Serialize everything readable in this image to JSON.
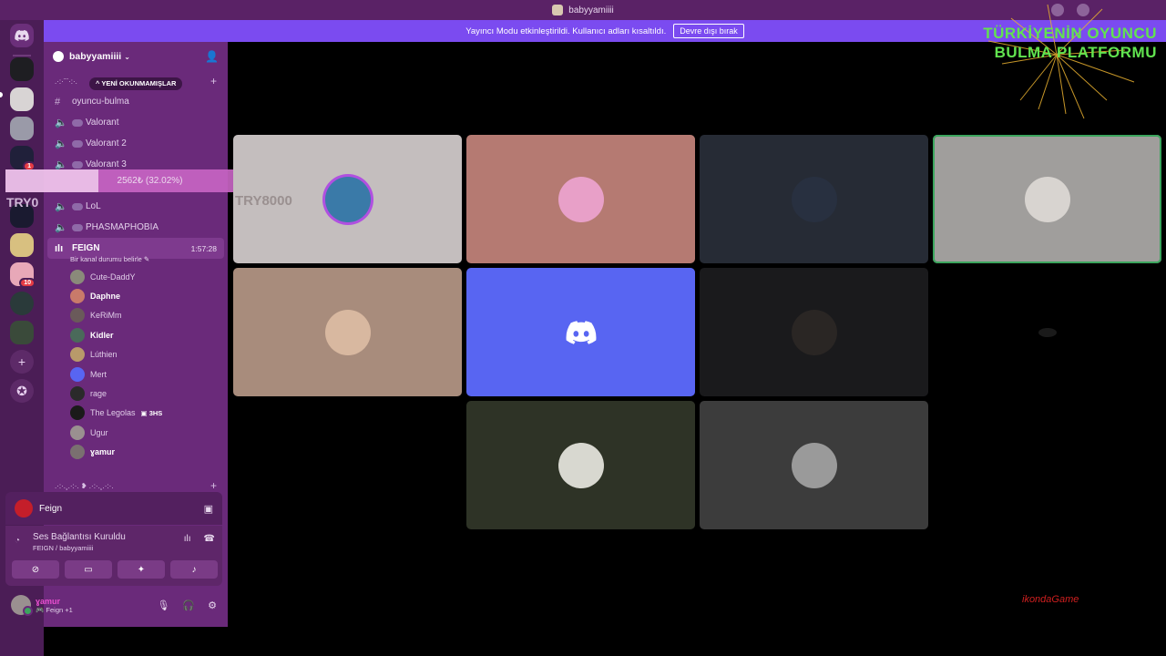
{
  "window": {
    "title": "babyyamiiii"
  },
  "banner": {
    "message": "Yayıncı Modu etkinleştirildi. Kullanıcı adları kısaltıldı.",
    "button_label": "Devre dışı bırak"
  },
  "rail": {
    "badge_1": "1",
    "badge_2": "10",
    "add_icon": "+"
  },
  "guild": {
    "name": "babyyamiiii"
  },
  "categories": {
    "top": ".·:·¨¨·:·.",
    "bottom": ".·:·.¸.·:·. ❥ .·:·.¸.·:·."
  },
  "unread_label": "YENİ OKUNMAMIŞLAR",
  "channels": [
    {
      "name": "oyuncu-bulma",
      "icon": "#"
    },
    {
      "name": "Valorant",
      "icon": "speaker"
    },
    {
      "name": "Valorant 2",
      "icon": "speaker"
    },
    {
      "name": "Valorant 3",
      "icon": "speaker"
    },
    {
      "name": "LoL",
      "icon": "speaker"
    },
    {
      "name": "PHASMAPHOBIA",
      "icon": "speaker"
    }
  ],
  "active_channel": {
    "name": "FEIGN",
    "timer": "1:57:28",
    "status": "Bir kanal durumu belirle"
  },
  "members": [
    {
      "name": "Cute-DaddY",
      "color": "#8a8a7a"
    },
    {
      "name": "Daphne",
      "color": "#c97a6a"
    },
    {
      "name": "KeRiMm",
      "color": "#6a5a5a"
    },
    {
      "name": "Kidler",
      "color": "#4a6a5a"
    },
    {
      "name": "Lúthien",
      "color": "#b89a6a"
    },
    {
      "name": "Mert",
      "color": "#5865f2"
    },
    {
      "name": "rage",
      "color": "#2a2a2a"
    },
    {
      "name": "The Legolas",
      "color": "#1a1a1a",
      "tag": "3HS"
    },
    {
      "name": "Ugur",
      "color": "#9a9090"
    },
    {
      "name": "ɣamur",
      "color": "#7a7070"
    }
  ],
  "progress": {
    "text": "2562₺ (32.02%)",
    "fraction": 0.3202
  },
  "overlay_label": "TRY0",
  "stream_panel": {
    "name": "Feign"
  },
  "voice_panel": {
    "title": "Ses Bağlantısı Kuruldu",
    "subtitle": "FEIGN / babyyamiiii"
  },
  "user_panel": {
    "name": "ɣamur",
    "status": "🎮 Feign +1"
  },
  "tiles": [
    {
      "bg": "#c4bebe",
      "avatar": "#3a7aa8",
      "label": "TRY8000"
    },
    {
      "bg": "#b57a72",
      "avatar": "#e8a0c8"
    },
    {
      "bg": "#262b35",
      "avatar": "#283040"
    },
    {
      "bg": "#a09e9c",
      "avatar": "#d8d4d0",
      "speaking": true
    },
    {
      "bg": "#a88c7c",
      "avatar": "#d8b8a0"
    },
    {
      "bg": "#5865f2",
      "avatar": "discord"
    },
    {
      "bg": "#1a1a1c",
      "avatar": "#2a2624"
    },
    {
      "bg": "#000000",
      "avatar": "#1a1a1a"
    },
    {
      "bg": "#2e3326",
      "avatar": "#d8d8d0"
    },
    {
      "bg": "#3c3c3c",
      "avatar": "#9a9a9a"
    }
  ],
  "brand": {
    "line1": "TÜRKİYENİN OYUNCU",
    "line2": "BULMA PLATFORMU"
  },
  "watermark": "ikondaGame"
}
